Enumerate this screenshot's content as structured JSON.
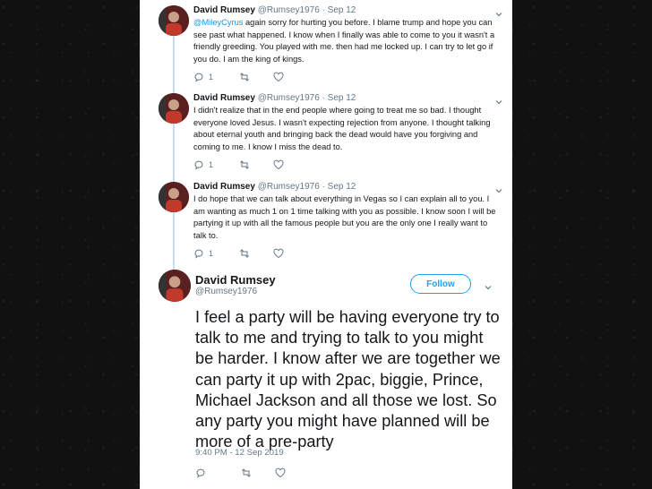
{
  "tweets": [
    {
      "name": "David Rumsey",
      "handle": "@Rumsey1976",
      "date": "· Sep 12",
      "mention": "@MileyCyrus",
      "text": " again sorry for hurting you before. I blame trump and hope you can see past what happened. I know when I finally was able to come to you it wasn't a friendly greeding. You played with me. then had me locked up. I can try to let go if you do. I am the king of kings.",
      "reply_count": "1"
    },
    {
      "name": "David Rumsey",
      "handle": "@Rumsey1976",
      "date": "· Sep 12",
      "text": "I didn't realize that in the end people where going to treat me so bad. I thought everyone loved Jesus. I wasn't expecting rejection from anyone. I thought talking about eternal youth and bringing back the dead would have you forgiving and coming to me. I know I miss the dead to.",
      "reply_count": "1"
    },
    {
      "name": "David Rumsey",
      "handle": "@Rumsey1976",
      "date": "· Sep 12",
      "text": "I do hope that we can talk about everything in Vegas so I can explain all to you. I am wanting as much 1 on 1 time talking with you as possible. I know soon I will be partying it up with all the famous people but you are the only one I really want to talk to.",
      "reply_count": "1"
    }
  ],
  "main_tweet": {
    "name": "David Rumsey",
    "handle": "@Rumsey1976",
    "follow_label": "Follow",
    "text": "I feel a party will be having everyone try to talk to me and trying to talk to you might be harder. I know after we are together we can party it up with 2pac, biggie, Prince, Michael Jackson and all those we lost. So any party you might have planned will be more of a pre-party",
    "timestamp": "9:40 PM - 12 Sep 2019"
  },
  "colors": {
    "accent": "#1da1f2",
    "mention": "#1b95e0",
    "muted": "#657786",
    "thread_line": "#c4dff3"
  },
  "icons": [
    "reply-icon",
    "retweet-icon",
    "like-icon",
    "chevron-down-icon",
    "avatar"
  ]
}
